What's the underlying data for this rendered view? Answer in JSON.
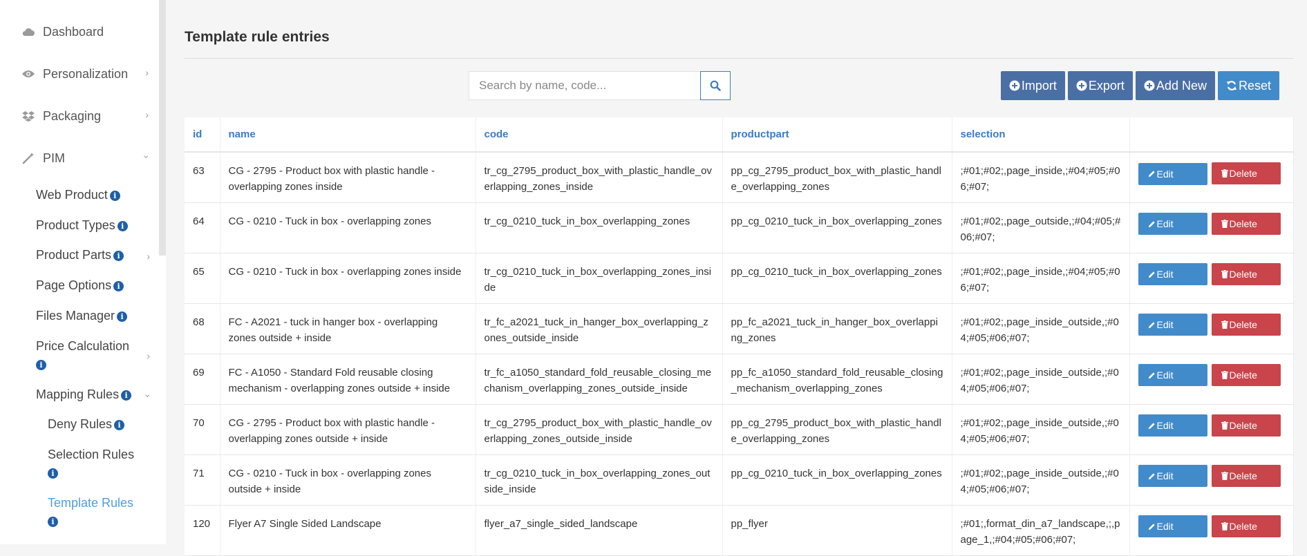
{
  "sidebar": {
    "items": [
      {
        "label": "Dashboard",
        "icon": "cloud-icon"
      },
      {
        "label": "Personalization",
        "icon": "eye-icon"
      },
      {
        "label": "Packaging",
        "icon": "dropbox-icon"
      },
      {
        "label": "PIM",
        "icon": "magic-wand-icon"
      }
    ],
    "pim_children": [
      {
        "label": "Web Product"
      },
      {
        "label": "Product Types"
      },
      {
        "label": "Product Parts"
      },
      {
        "label": "Page Options"
      },
      {
        "label": "Files Manager"
      },
      {
        "label": "Price Calculation"
      },
      {
        "label": "Mapping Rules"
      }
    ],
    "mapping_children": [
      {
        "label": "Deny Rules"
      },
      {
        "label": "Selection Rules"
      },
      {
        "label": "Template Rules"
      }
    ],
    "info_glyph": "i"
  },
  "page": {
    "title": "Template rule entries"
  },
  "search": {
    "placeholder": "Search by name, code..."
  },
  "toolbar": {
    "import_label": "Import",
    "export_label": "Export",
    "add_label": "Add New",
    "reset_label": "Reset"
  },
  "table": {
    "columns": [
      "id",
      "name",
      "code",
      "productpart",
      "selection",
      ""
    ],
    "edit_label": "Edit",
    "delete_label": "Delete",
    "rows": [
      {
        "id": "63",
        "name": "CG - 2795 - Product box with plastic handle - overlapping zones inside",
        "code": "tr_cg_2795_product_box_with_plastic_handle_overlapping_zones_inside",
        "productpart": "pp_cg_2795_product_box_with_plastic_handle_overlapping_zones",
        "selection": ";#01;#02;,page_inside,;#04;#05;#06;#07;"
      },
      {
        "id": "64",
        "name": "CG - 0210 - Tuck in box - overlapping zones",
        "code": "tr_cg_0210_tuck_in_box_overlapping_zones",
        "productpart": "pp_cg_0210_tuck_in_box_overlapping_zones",
        "selection": ";#01;#02;,page_outside,;#04;#05;#06;#07;"
      },
      {
        "id": "65",
        "name": "CG - 0210 - Tuck in box - overlapping zones inside",
        "code": "tr_cg_0210_tuck_in_box_overlapping_zones_inside",
        "productpart": "pp_cg_0210_tuck_in_box_overlapping_zones",
        "selection": ";#01;#02;,page_inside,;#04;#05;#06;#07;"
      },
      {
        "id": "68",
        "name": "FC - A2021 - tuck in hanger box - overlapping zones outside + inside",
        "code": "tr_fc_a2021_tuck_in_hanger_box_overlapping_zones_outside_inside",
        "productpart": "pp_fc_a2021_tuck_in_hanger_box_overlapping_zones",
        "selection": ";#01;#02;,page_inside_outside,;#04;#05;#06;#07;"
      },
      {
        "id": "69",
        "name": "FC - A1050 - Standard Fold reusable closing mechanism - overlapping zones outside + inside",
        "code": "tr_fc_a1050_standard_fold_reusable_closing_mechanism_overlapping_zones_outside_inside",
        "productpart": "pp_fc_a1050_standard_fold_reusable_closing_mechanism_overlapping_zones",
        "selection": ";#01;#02;,page_inside_outside,;#04;#05;#06;#07;"
      },
      {
        "id": "70",
        "name": "CG - 2795 - Product box with plastic handle - overlapping zones outside + inside",
        "code": "tr_cg_2795_product_box_with_plastic_handle_overlapping_zones_outside_inside",
        "productpart": "pp_cg_2795_product_box_with_plastic_handle_overlapping_zones",
        "selection": ";#01;#02;,page_inside_outside,;#04;#05;#06;#07;"
      },
      {
        "id": "71",
        "name": "CG - 0210 - Tuck in box - overlapping zones outside + inside",
        "code": "tr_cg_0210_tuck_in_box_overlapping_zones_outside_inside",
        "productpart": "pp_cg_0210_tuck_in_box_overlapping_zones",
        "selection": ";#01;#02;,page_inside_outside,;#04;#05;#06;#07;"
      },
      {
        "id": "120",
        "name": "Flyer A7 Single Sided Landscape",
        "code": "flyer_a7_single_sided_landscape",
        "productpart": "pp_flyer",
        "selection": ";#01;,format_din_a7_landscape,;,page_1,;#04;#05;#06;#07;"
      }
    ]
  },
  "colors": {
    "accent": "#428bca",
    "dark_button": "#4a6fa5",
    "danger": "#c9444b",
    "active_nav": "#4d9ee6",
    "info_badge": "#1f5fa6"
  }
}
